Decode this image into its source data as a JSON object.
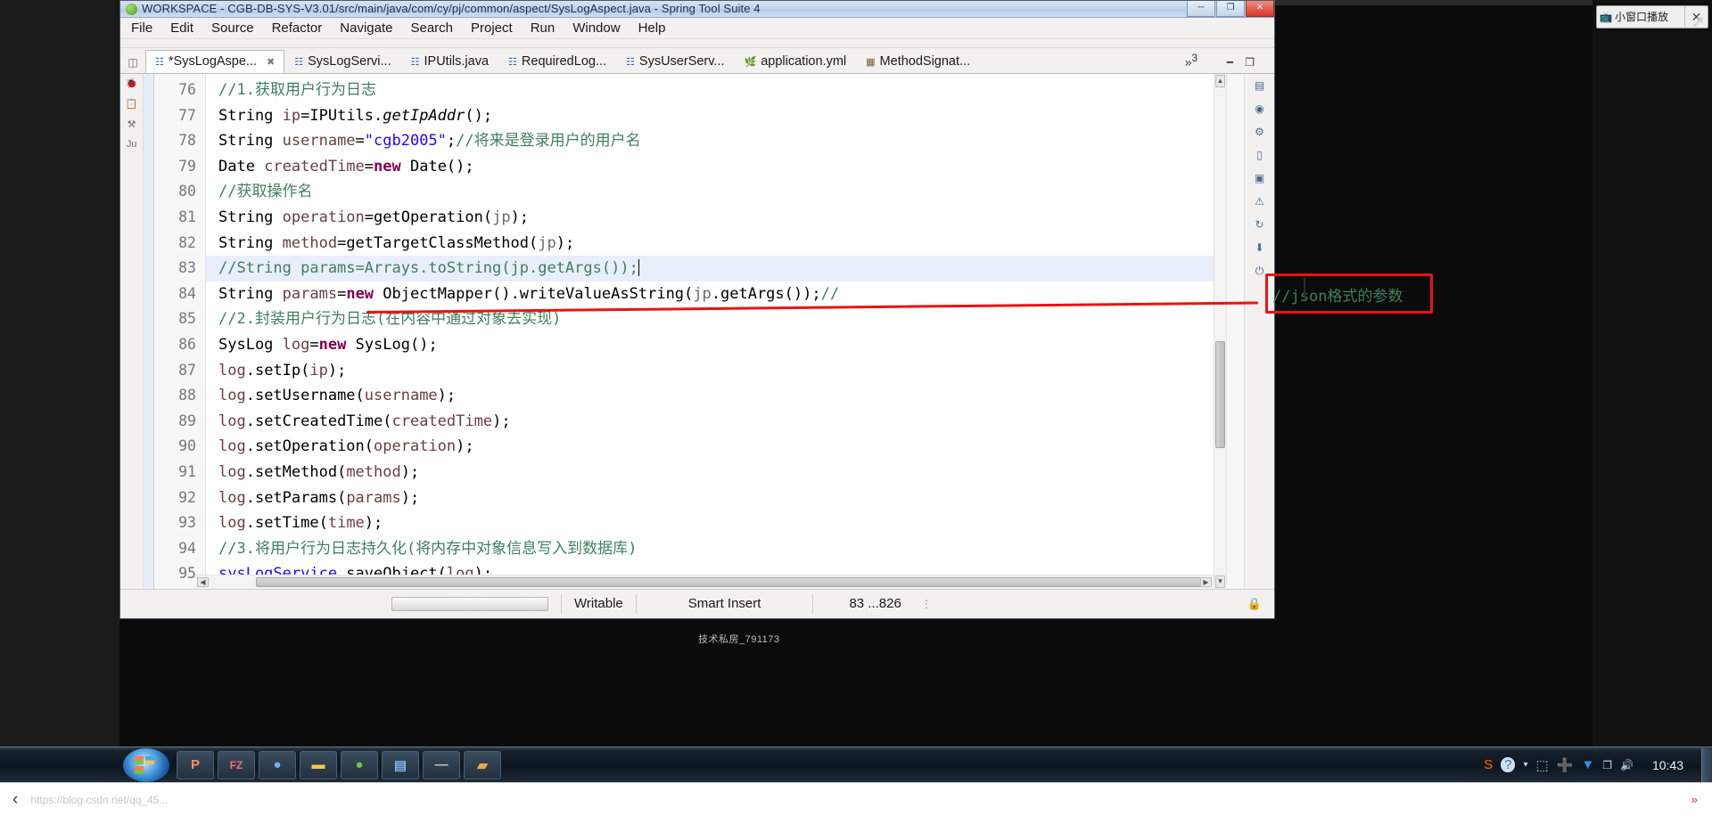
{
  "window": {
    "title": "WORKSPACE - CGB-DB-SYS-V3.01/src/main/java/com/cy/pj/common/aspect/SysLogAspect.java - Spring Tool Suite 4",
    "app_icon": "sts-icon",
    "minimize_label": "─",
    "maximize_label": "❐",
    "close_label": "✕"
  },
  "menubar": {
    "items": [
      "File",
      "Edit",
      "Source",
      "Refactor",
      "Navigate",
      "Search",
      "Project",
      "Run",
      "Window",
      "Help"
    ]
  },
  "tabs": {
    "gutter_icon": "editor-list-icon",
    "items": [
      {
        "label": "*SysLogAspe...",
        "icon": "java-file-icon",
        "active": true,
        "closable": true
      },
      {
        "label": "SysLogServi...",
        "icon": "java-file-icon",
        "active": false,
        "closable": false
      },
      {
        "label": "IPUtils.java",
        "icon": "java-file-icon",
        "active": false,
        "closable": false
      },
      {
        "label": "RequiredLog...",
        "icon": "java-file-icon",
        "active": false,
        "closable": false
      },
      {
        "label": "SysUserServ...",
        "icon": "java-file-icon",
        "active": false,
        "closable": false
      },
      {
        "label": "application.yml",
        "icon": "yaml-file-icon",
        "active": false,
        "closable": false
      },
      {
        "label": "MethodSignat...",
        "icon": "binary-file-icon",
        "active": false,
        "closable": false
      }
    ],
    "overflow_label": "»",
    "overflow_count": "3",
    "minimize_label": "━",
    "maximize_label": "❐"
  },
  "editor": {
    "first_line_number": 76,
    "lines": [
      {
        "n": 76,
        "highlight": false,
        "tokens": [
          {
            "t": "c",
            "x": "//1."
          },
          {
            "t": "c",
            "x": "获取用户行为日志"
          }
        ]
      },
      {
        "n": 77,
        "highlight": false,
        "tokens": [
          {
            "t": "t",
            "x": "String "
          },
          {
            "t": "v",
            "x": "ip"
          },
          {
            "t": "t",
            "x": "=IPUtils."
          },
          {
            "t": "f",
            "x": "getIpAddr"
          },
          {
            "t": "t",
            "x": "();"
          }
        ]
      },
      {
        "n": 78,
        "highlight": false,
        "tokens": [
          {
            "t": "t",
            "x": "String "
          },
          {
            "t": "v",
            "x": "username"
          },
          {
            "t": "t",
            "x": "="
          },
          {
            "t": "s",
            "x": "\"cgb2005\""
          },
          {
            "t": "t",
            "x": ";"
          },
          {
            "t": "c",
            "x": "//将来是登录用户的用户名"
          }
        ]
      },
      {
        "n": 79,
        "highlight": false,
        "tokens": [
          {
            "t": "t",
            "x": "Date "
          },
          {
            "t": "v",
            "x": "createdTime"
          },
          {
            "t": "t",
            "x": "="
          },
          {
            "t": "k",
            "x": "new"
          },
          {
            "t": "t",
            "x": " Date();"
          }
        ]
      },
      {
        "n": 80,
        "highlight": false,
        "tokens": [
          {
            "t": "c",
            "x": "//获取操作名"
          }
        ]
      },
      {
        "n": 81,
        "highlight": false,
        "tokens": [
          {
            "t": "t",
            "x": "String "
          },
          {
            "t": "v",
            "x": "operation"
          },
          {
            "t": "t",
            "x": "=getOperation("
          },
          {
            "t": "p",
            "x": "jp"
          },
          {
            "t": "t",
            "x": ");"
          }
        ]
      },
      {
        "n": 82,
        "highlight": false,
        "tokens": [
          {
            "t": "t",
            "x": "String "
          },
          {
            "t": "v",
            "x": "method"
          },
          {
            "t": "t",
            "x": "=getTargetClassMethod("
          },
          {
            "t": "p",
            "x": "jp"
          },
          {
            "t": "t",
            "x": ");"
          }
        ]
      },
      {
        "n": 83,
        "highlight": true,
        "tokens": [
          {
            "t": "c",
            "x": "//String params=Arrays.toString(jp.getArgs());"
          },
          {
            "t": "caret",
            "x": ""
          }
        ]
      },
      {
        "n": 84,
        "highlight": false,
        "tokens": [
          {
            "t": "t",
            "x": "String "
          },
          {
            "t": "v",
            "x": "params"
          },
          {
            "t": "t",
            "x": "="
          },
          {
            "t": "k",
            "x": "new"
          },
          {
            "t": "t",
            "x": " ObjectMapper().writeValueAsString("
          },
          {
            "t": "p",
            "x": "jp"
          },
          {
            "t": "t",
            "x": ".getArgs());"
          },
          {
            "t": "c",
            "x": "//"
          }
        ]
      },
      {
        "n": 85,
        "highlight": false,
        "tokens": [
          {
            "t": "c",
            "x": "//2."
          },
          {
            "t": "c",
            "x": "封装用户行为日志(在内容中通过对象去实现)"
          }
        ]
      },
      {
        "n": 86,
        "highlight": false,
        "tokens": [
          {
            "t": "t",
            "x": "SysLog "
          },
          {
            "t": "v",
            "x": "log"
          },
          {
            "t": "t",
            "x": "="
          },
          {
            "t": "k",
            "x": "new"
          },
          {
            "t": "t",
            "x": " SysLog();"
          }
        ]
      },
      {
        "n": 87,
        "highlight": false,
        "tokens": [
          {
            "t": "v",
            "x": "log"
          },
          {
            "t": "t",
            "x": ".setIp("
          },
          {
            "t": "v",
            "x": "ip"
          },
          {
            "t": "t",
            "x": ");"
          }
        ]
      },
      {
        "n": 88,
        "highlight": false,
        "tokens": [
          {
            "t": "v",
            "x": "log"
          },
          {
            "t": "t",
            "x": ".setUsername("
          },
          {
            "t": "v",
            "x": "username"
          },
          {
            "t": "t",
            "x": ");"
          }
        ]
      },
      {
        "n": 89,
        "highlight": false,
        "tokens": [
          {
            "t": "v",
            "x": "log"
          },
          {
            "t": "t",
            "x": ".setCreatedTime("
          },
          {
            "t": "v",
            "x": "createdTime"
          },
          {
            "t": "t",
            "x": ");"
          }
        ]
      },
      {
        "n": 90,
        "highlight": false,
        "tokens": [
          {
            "t": "v",
            "x": "log"
          },
          {
            "t": "t",
            "x": ".setOperation("
          },
          {
            "t": "v",
            "x": "operation"
          },
          {
            "t": "t",
            "x": ");"
          }
        ]
      },
      {
        "n": 91,
        "highlight": false,
        "tokens": [
          {
            "t": "v",
            "x": "log"
          },
          {
            "t": "t",
            "x": ".setMethod("
          },
          {
            "t": "v",
            "x": "method"
          },
          {
            "t": "t",
            "x": ");"
          }
        ]
      },
      {
        "n": 92,
        "highlight": false,
        "tokens": [
          {
            "t": "v",
            "x": "log"
          },
          {
            "t": "t",
            "x": ".setParams("
          },
          {
            "t": "v",
            "x": "params"
          },
          {
            "t": "t",
            "x": ");"
          }
        ]
      },
      {
        "n": 93,
        "highlight": false,
        "tokens": [
          {
            "t": "v",
            "x": "log"
          },
          {
            "t": "t",
            "x": ".setTime("
          },
          {
            "t": "v",
            "x": "time"
          },
          {
            "t": "t",
            "x": ");"
          }
        ]
      },
      {
        "n": 94,
        "highlight": false,
        "tokens": [
          {
            "t": "c",
            "x": "//3."
          },
          {
            "t": "c",
            "x": "将用户行为日志持久化(将内存中对象信息写入到数据库)"
          }
        ]
      },
      {
        "n": 95,
        "highlight": false,
        "tokens": [
          {
            "t": "u",
            "x": "sysLogService"
          },
          {
            "t": "t",
            "x": ".saveObject("
          },
          {
            "t": "v",
            "x": "log"
          },
          {
            "t": "t",
            "x": ");"
          }
        ]
      }
    ],
    "watermark": "技术私房_791173"
  },
  "annotation": {
    "color": "#ee1111",
    "box_text": "//json格式的参数",
    "box_text_code": "//",
    "box_text_rest": "json",
    "box_text_cn": "格式的参数",
    "underline_present": "true"
  },
  "statusbar": {
    "writable": "Writable",
    "insert_mode": "Smart Insert",
    "position": "83 ...826",
    "progress_value": ""
  },
  "taskbar": {
    "start_label": "start",
    "items": [
      {
        "name": "powerpoint",
        "label": "P",
        "color": "#d24726"
      },
      {
        "name": "filezilla",
        "label": "FZ",
        "color": "#bf2428"
      },
      {
        "name": "chrome",
        "label": "●",
        "color": "#4285f4"
      },
      {
        "name": "explorer",
        "label": "▬",
        "color": "#f5c842"
      },
      {
        "name": "browser2",
        "label": "●",
        "color": "#3aa03a"
      },
      {
        "name": "notes",
        "label": "▤",
        "color": "#2f6fb5"
      },
      {
        "name": "editor",
        "label": "—",
        "color": "#8a8a8a"
      },
      {
        "name": "sts",
        "label": "▰",
        "color": "#e08a2a"
      }
    ],
    "tray": [
      {
        "name": "sogou-input",
        "glyph": "S",
        "color": "#ff6a00"
      },
      {
        "name": "help",
        "glyph": "?",
        "color": "#1b5fa8"
      },
      {
        "name": "overflow",
        "glyph": "▾",
        "color": "#c8d6e2"
      },
      {
        "name": "screenshot",
        "glyph": "⬚",
        "color": "#b9c7d4"
      },
      {
        "name": "updater",
        "glyph": "➕",
        "color": "#f5c842"
      },
      {
        "name": "security",
        "glyph": "▼",
        "color": "#2f8fd8"
      },
      {
        "name": "network",
        "glyph": "❐",
        "color": "#d0dae4"
      },
      {
        "name": "volume",
        "glyph": "🔊",
        "color": "#dfe7ee"
      }
    ],
    "clock": "10:43"
  },
  "mini_player": {
    "icon": "tv-icon",
    "label": "小窗口播放",
    "close_label": "✕"
  },
  "bottom_bar": {
    "back_label": "‹",
    "url_watermark": "https://blog.csdn.net/qq_45...",
    "right_label": "»"
  }
}
